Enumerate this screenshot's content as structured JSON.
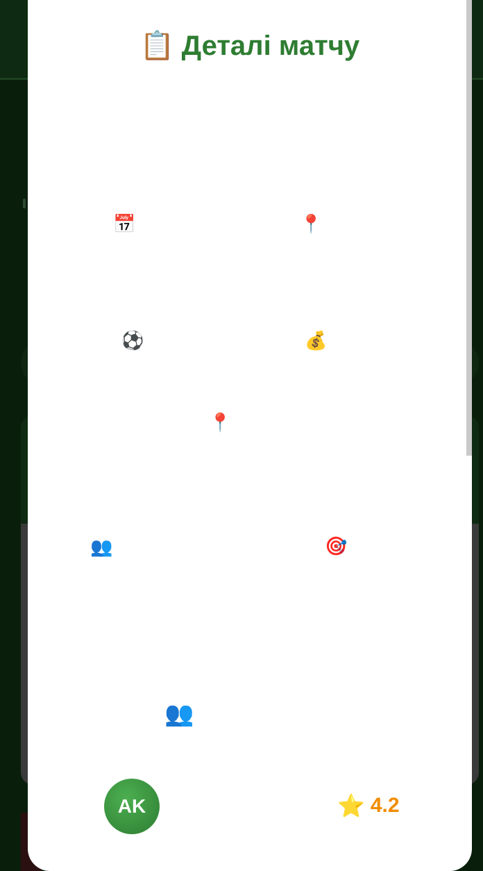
{
  "modal": {
    "title": "Деталі матчу",
    "title_icon": "📋"
  },
  "details_icons": {
    "date_icon": "📅",
    "location_icon": "📍",
    "sport_icon": "⚽",
    "price_icon": "💰",
    "address_icon": "📍",
    "players_icon": "👥",
    "level_icon": "🎯",
    "participants_icon": "👥"
  },
  "organizer": {
    "initials": "AK",
    "rating_icon": "⭐",
    "rating": "4.2"
  }
}
